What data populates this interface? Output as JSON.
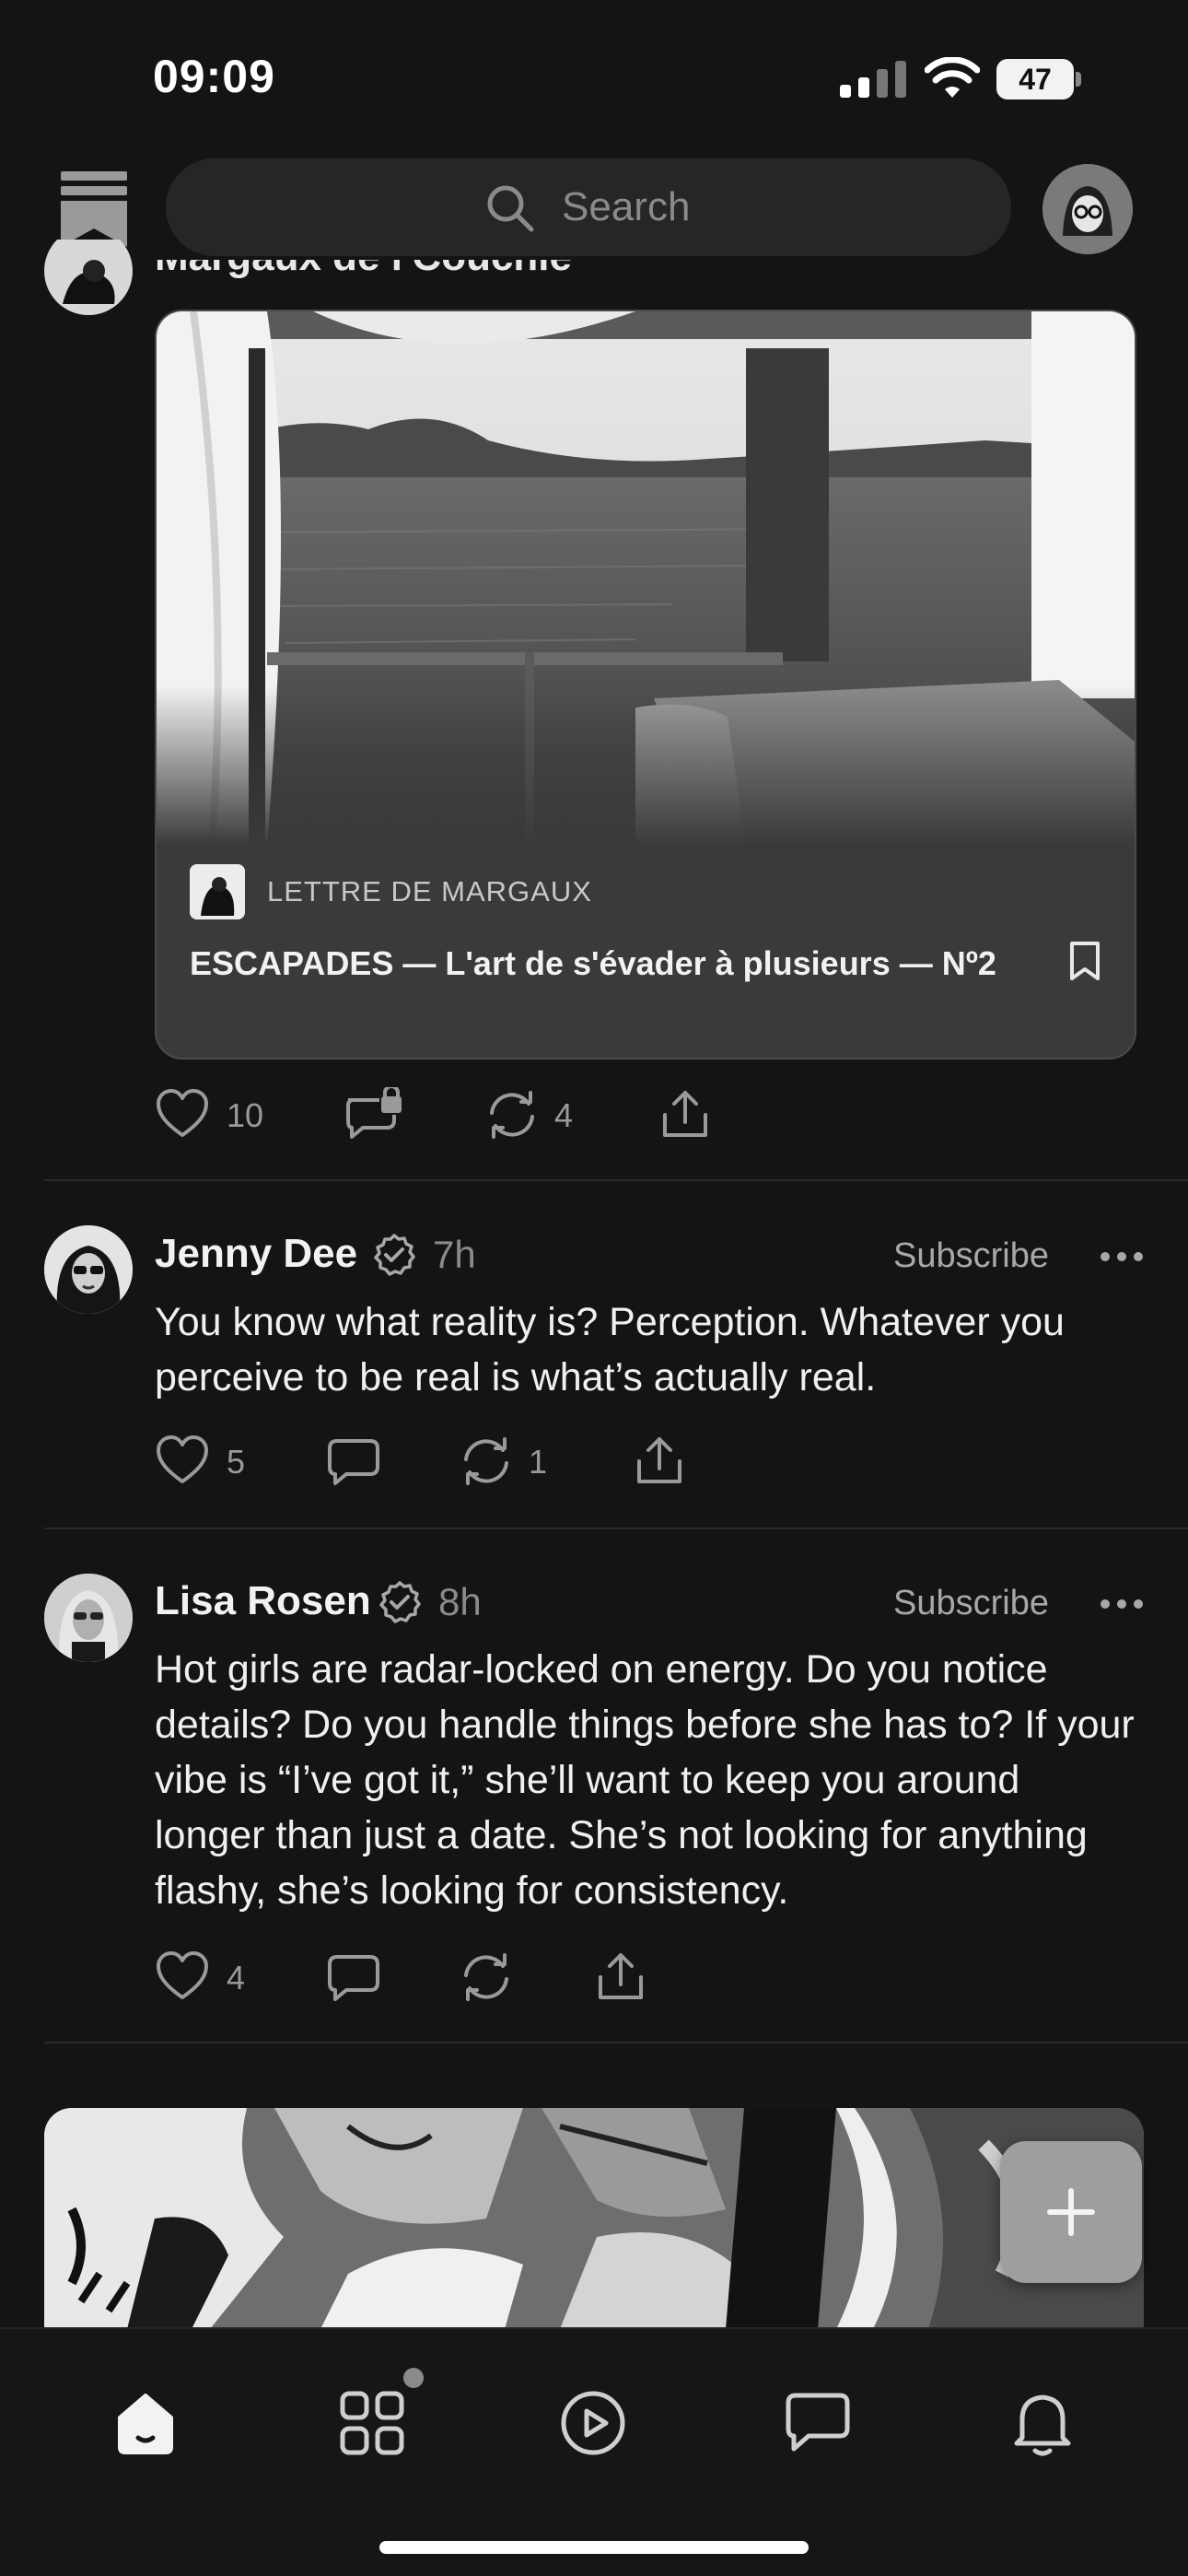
{
  "status_bar": {
    "time": "09:09",
    "battery": "47"
  },
  "header": {
    "search_placeholder": "Search"
  },
  "post1": {
    "author_partial": "Margaux de l'Couchie",
    "publication": "LETTRE DE MARGAUX",
    "title": "ESCAPADES — L'art de s'évader à plusieurs — Nº2",
    "likes": "10",
    "restacks": "4"
  },
  "post2": {
    "author": "Jenny Dee",
    "time": "7h",
    "subscribe": "Subscribe",
    "body": "You know what reality is? Perception. Whatever you perceive to be real is what’s actually real.",
    "likes": "5",
    "restacks": "1"
  },
  "post3": {
    "author": "Lisa Rosen",
    "time": "8h",
    "subscribe": "Subscribe",
    "body": "Hot girls are radar-locked on energy. Do you notice details? Do you handle things before she has to? If your vibe is “I’ve got it,” she’ll want to keep you around longer than just a date. She’s not looking for anything flashy, she’s looking for consistency.",
    "likes": "4"
  },
  "tabs": [
    "home-tab",
    "library-tab",
    "video-tab",
    "chat-tab",
    "notifications-tab"
  ],
  "icons": [
    "feed-icon",
    "search-icon",
    "bookmark-icon",
    "heart-icon",
    "comment-locked-icon",
    "restack-icon",
    "share-icon",
    "verified-icon",
    "more-icon",
    "plus-icon"
  ],
  "colors": {
    "background": "#141414",
    "card": "#3a3a3a",
    "muted": "#8a8a8a"
  }
}
